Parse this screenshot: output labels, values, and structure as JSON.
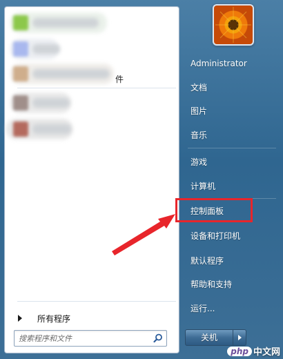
{
  "left_pane": {
    "pinned_tail_text": "件",
    "all_programs_label": "所有程序",
    "search_placeholder": "搜索程序和文件"
  },
  "right_pane": {
    "user_name": "Administrator",
    "items": [
      {
        "label": "文档"
      },
      {
        "label": "图片"
      },
      {
        "label": "音乐"
      },
      {
        "label": "游戏"
      },
      {
        "label": "计算机"
      },
      {
        "label": "控制面板"
      },
      {
        "label": "设备和打印机"
      },
      {
        "label": "默认程序"
      },
      {
        "label": "帮助和支持"
      },
      {
        "label": "运行..."
      }
    ],
    "shutdown_label": "关机"
  },
  "watermark": {
    "logo": "php",
    "text": "中文网"
  },
  "colors": {
    "highlight_box": "#e8252b",
    "annotation_arrow": "#e8252b",
    "menu_background": "#2f6690"
  }
}
